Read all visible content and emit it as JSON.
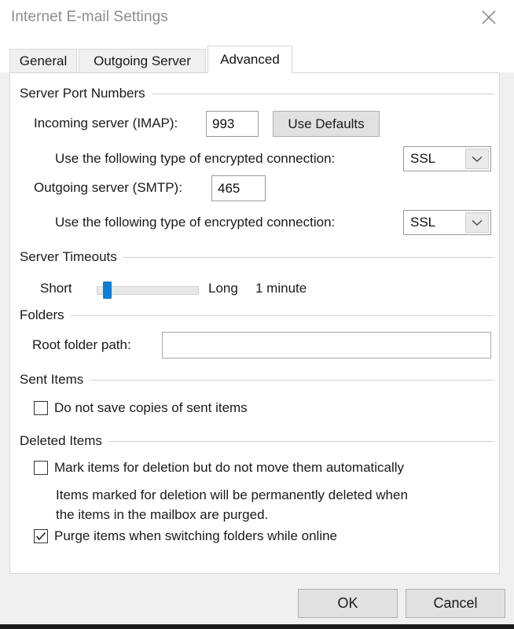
{
  "window": {
    "title": "Internet E-mail Settings",
    "close_icon": "close-icon"
  },
  "tabs": [
    {
      "label": "General",
      "active": false
    },
    {
      "label": "Outgoing Server",
      "active": false
    },
    {
      "label": "Advanced",
      "active": true
    }
  ],
  "groups": {
    "server_ports": {
      "label": "Server Port Numbers",
      "incoming_label": "Incoming server (IMAP):",
      "incoming_value": "993",
      "use_defaults_label": "Use Defaults",
      "incoming_encryption_label": "Use the following type of encrypted connection:",
      "incoming_encryption_value": "SSL",
      "outgoing_label": "Outgoing server (SMTP):",
      "outgoing_value": "465",
      "outgoing_encryption_label": "Use the following type of encrypted connection:",
      "outgoing_encryption_value": "SSL"
    },
    "server_timeouts": {
      "label": "Server Timeouts",
      "short_label": "Short",
      "long_label": "Long",
      "value_label": "1 minute",
      "slider_percent": 10,
      "accent_color": "#0a7fd4"
    },
    "folders": {
      "label": "Folders",
      "root_folder_label": "Root folder path:",
      "root_folder_value": "",
      "root_folder_placeholder": ""
    },
    "sent_items": {
      "label": "Sent Items",
      "do_not_save_label": "Do not save copies of sent items",
      "do_not_save_checked": false
    },
    "deleted_items": {
      "label": "Deleted Items",
      "mark_items_label": "Mark items for deletion but do not move them automatically",
      "mark_items_checked": false,
      "help_text": "Items marked for deletion will be permanently deleted when\nthe items in the mailbox are purged.",
      "purge_label": "Purge items when switching folders while online",
      "purge_checked": true
    }
  },
  "footer": {
    "ok_label": "OK",
    "cancel_label": "Cancel"
  }
}
